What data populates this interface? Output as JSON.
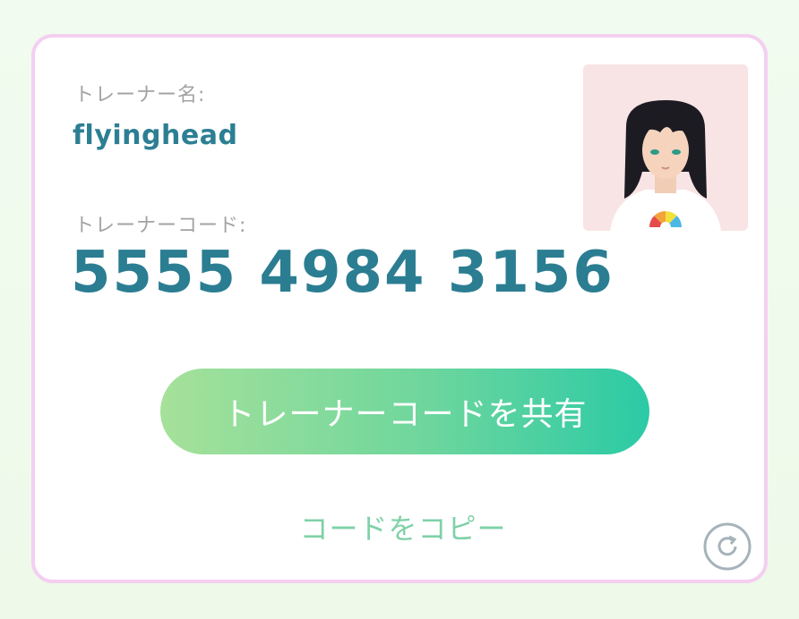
{
  "trainer": {
    "name_label": "トレーナー名:",
    "name": "flyinghead",
    "code_label": "トレーナーコード:",
    "code": "5555 4984 3156"
  },
  "actions": {
    "share_label": "トレーナーコードを共有",
    "copy_label": "コードをコピー"
  },
  "icons": {
    "avatar": "trainer-avatar",
    "refresh": "refresh-icon"
  },
  "colors": {
    "accent_text": "#2b7d92",
    "border": "#f4cff1",
    "button_start": "#a6e19a",
    "button_end": "#2bcaa6",
    "copy_text": "#7fd1a8"
  }
}
